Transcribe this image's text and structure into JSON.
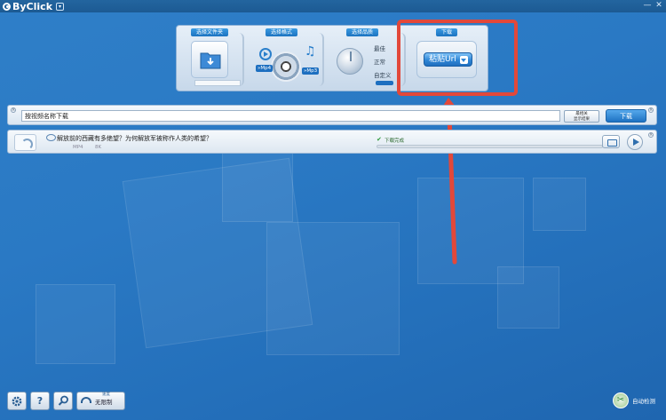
{
  "app": {
    "title": "ByClick"
  },
  "window": {
    "minimize": "—",
    "close": "✕"
  },
  "panel": {
    "folder": {
      "title": "选择文件夹"
    },
    "format": {
      "title": "选择格式",
      "mp4": "»Mp4",
      "mp3": "»Mp3"
    },
    "quality": {
      "title": "选择品质",
      "options": [
        "最佳",
        "正常",
        "自定义"
      ]
    },
    "download": {
      "title": "下载",
      "paste_label": "粘贴Url"
    }
  },
  "urlbar": {
    "input_value": "按视频名称下载",
    "clipboard_line1": "最相关",
    "clipboard_line2": "显示结果",
    "download_label": "下载"
  },
  "download_item": {
    "title": "解放前的西藏有多绝望？为何解放军被称作人类的希望？",
    "format": "MP4",
    "size": "8K",
    "status": "下载完成",
    "progress": 1.0
  },
  "bottom": {
    "settings_icon": "gear-icon",
    "help_label": "?",
    "search_icon": "search-icon",
    "speed_small": "速度",
    "speed_label": "无限制",
    "auto_detect": "自动检测"
  },
  "colors": {
    "accent": "#1e72c2",
    "highlight": "#e2483a",
    "background": "#2a79c4"
  }
}
